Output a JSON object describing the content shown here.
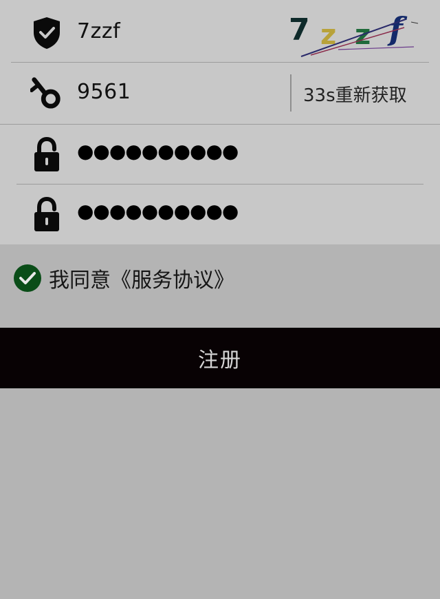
{
  "form": {
    "captcha": {
      "value": "7zzf",
      "image_chars": [
        "7",
        "z",
        "z",
        "f"
      ],
      "char_colors": [
        "#0e2a2a",
        "#b8a23a",
        "#1f6a3a",
        "#142a6a"
      ],
      "icon": "shield-check-icon"
    },
    "sms_code": {
      "value": "9561",
      "icon": "key-icon",
      "resend_label": "33s重新获取"
    },
    "password": {
      "masked": "●●●●●●●●●●",
      "icon": "lock-icon"
    },
    "confirm_password": {
      "masked": "●●●●●●●●●●",
      "icon": "lock-icon"
    }
  },
  "agreement": {
    "checked": true,
    "label": "我同意《服务协议》",
    "check_color": "#0a4d18"
  },
  "register_button": {
    "label": "注册",
    "background": "#080204"
  }
}
